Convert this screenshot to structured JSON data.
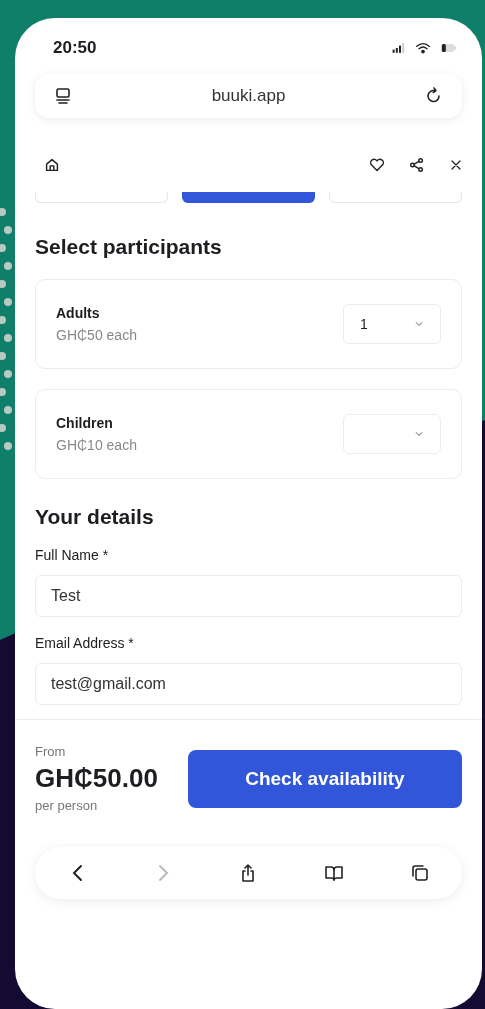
{
  "status_bar": {
    "time": "20:50"
  },
  "address_bar": {
    "url": "buuki.app"
  },
  "step_tabs": [
    {
      "selected": false
    },
    {
      "selected": true
    },
    {
      "selected": false
    }
  ],
  "participants": {
    "title": "Select participants",
    "items": [
      {
        "name": "Adults",
        "price": "GH₵50 each",
        "value": "1"
      },
      {
        "name": "Children",
        "price": "GH₵10 each",
        "value": ""
      }
    ]
  },
  "details": {
    "title": "Your details",
    "fields": [
      {
        "label": "Full Name *",
        "value": "Test"
      },
      {
        "label": "Email Address *",
        "value": "test@gmail.com"
      }
    ]
  },
  "footer": {
    "prefix": "From",
    "price": "GH₵50.00",
    "suffix": "per person",
    "button": "Check availability"
  },
  "browser_bar": {
    "back_disabled": false,
    "forward_disabled": true
  }
}
